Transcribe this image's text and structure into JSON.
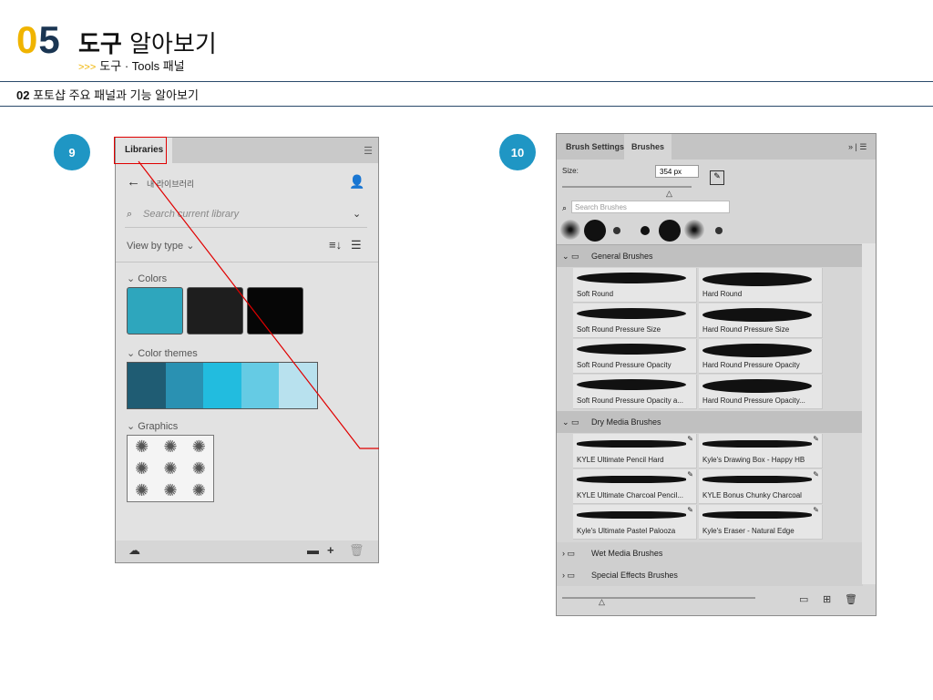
{
  "header": {
    "num_a": "0",
    "num_b": "5",
    "title_bold": "도구",
    "title_rest": "알아보기",
    "sub_arrow": ">>>",
    "sub_text": "도구 · Tools 패널"
  },
  "section": {
    "num": "02",
    "text": "포토샵 주요 패널과 기능 알아보기"
  },
  "steps": [
    "9",
    "10"
  ],
  "libraries": {
    "tab": "Libraries",
    "library_name": "내 라이브러리",
    "search_placeholder": "Search current library",
    "view_by": "View by type",
    "colors_label": "Colors",
    "color_swatches": [
      "#2ea6bd",
      "#1e1e1e",
      "#060606"
    ],
    "themes_label": "Color themes",
    "theme_colors": [
      "#1f5c73",
      "#2a91b2",
      "#22bcdf",
      "#65cbe4",
      "#b8e1ee"
    ],
    "graphics_label": "Graphics"
  },
  "brushes": {
    "tab1": "Brush Settings",
    "tab2": "Brushes",
    "size_label": "Size:",
    "size_value": "354 px",
    "search_placeholder": "Search Brushes",
    "groups": [
      {
        "name": "General Brushes"
      },
      {
        "name": "Dry Media Brushes"
      },
      {
        "name": "Wet Media Brushes"
      },
      {
        "name": "Special Effects Brushes"
      }
    ],
    "general": [
      "Soft Round",
      "Hard Round",
      "Soft Round Pressure Size",
      "Hard Round Pressure Size",
      "Soft Round Pressure Opacity",
      "Hard Round Pressure Opacity",
      "Soft Round Pressure Opacity a...",
      "Hard Round Pressure Opacity..."
    ],
    "dry": [
      "KYLE Ultimate Pencil Hard",
      "Kyle's Drawing Box - Happy HB",
      "KYLE Ultimate Charcoal Pencil...",
      "KYLE Bonus Chunky Charcoal",
      "Kyle's Ultimate Pastel Palooza",
      "Kyle's Eraser - Natural Edge"
    ]
  },
  "colors": {
    "accent": "#1f96c4",
    "highlight": "#e00000"
  }
}
